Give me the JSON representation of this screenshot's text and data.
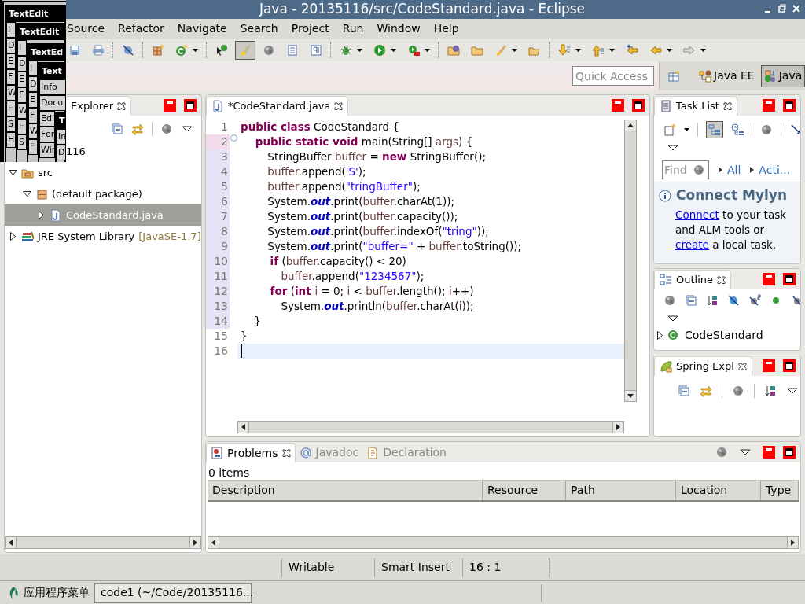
{
  "window": {
    "title": "Java - 20135116/src/CodeStandard.java - Eclipse"
  },
  "textedit_windows": [
    {
      "title": "TextEdit",
      "items": [
        {
          "label": "I",
          "disabled": false
        },
        {
          "label": "D",
          "disabled": false
        },
        {
          "label": "E",
          "disabled": false
        },
        {
          "label": "F",
          "disabled": false
        },
        {
          "label": "W",
          "disabled": false
        },
        {
          "label": "F",
          "disabled": true
        },
        {
          "label": "S",
          "disabled": false
        },
        {
          "label": "H",
          "disabled": false
        }
      ]
    },
    {
      "title": "TextEdit",
      "items": [
        {
          "label": "I",
          "disabled": false
        },
        {
          "label": "D",
          "disabled": false
        },
        {
          "label": "E",
          "disabled": false
        },
        {
          "label": "F",
          "disabled": false
        },
        {
          "label": "W",
          "disabled": false
        },
        {
          "label": "F",
          "disabled": true
        },
        {
          "label": "S",
          "disabled": false
        }
      ]
    },
    {
      "title": "TextEd",
      "items": [
        {
          "label": "I",
          "disabled": false
        },
        {
          "label": "D",
          "disabled": false
        },
        {
          "label": "E",
          "disabled": false
        },
        {
          "label": "F",
          "disabled": false
        },
        {
          "label": "W",
          "disabled": false
        },
        {
          "label": "F",
          "disabled": true
        }
      ]
    },
    {
      "title": "Text",
      "items": [
        {
          "label": "Info",
          "disabled": false
        },
        {
          "label": "Docu",
          "disabled": false
        },
        {
          "label": "Edi",
          "disabled": false
        },
        {
          "label": "For",
          "disabled": false
        },
        {
          "label": "Wir",
          "disabled": false
        }
      ]
    },
    {
      "title": "T",
      "items": [
        {
          "label": "In",
          "disabled": false
        },
        {
          "label": "D",
          "disabled": false
        }
      ]
    }
  ],
  "menu": [
    "Source",
    "Refactor",
    "Navigate",
    "Search",
    "Project",
    "Run",
    "Window",
    "Help"
  ],
  "toolbar": [
    [
      {
        "kind": "save",
        "dropdown": false,
        "selected": false
      },
      {
        "kind": "print",
        "dropdown": false,
        "selected": false
      }
    ],
    [
      {
        "kind": "hide",
        "dropdown": false,
        "selected": false
      }
    ],
    [
      {
        "kind": "new-package",
        "dropdown": false,
        "selected": false
      },
      {
        "kind": "new-class",
        "dropdown": true,
        "selected": false
      }
    ],
    [
      {
        "kind": "open-type",
        "dropdown": false,
        "selected": false
      },
      {
        "kind": "highlight",
        "dropdown": false,
        "selected": true
      },
      {
        "kind": "blob",
        "dropdown": false,
        "selected": false
      },
      {
        "kind": "document",
        "dropdown": false,
        "selected": false
      },
      {
        "kind": "paragraph",
        "dropdown": false,
        "selected": false
      }
    ],
    [
      {
        "kind": "debug",
        "dropdown": true,
        "selected": false
      },
      {
        "kind": "run",
        "dropdown": true,
        "selected": false
      },
      {
        "kind": "run-tool",
        "dropdown": true,
        "selected": false
      }
    ],
    [
      {
        "kind": "folder-globe",
        "dropdown": false,
        "selected": false
      },
      {
        "kind": "folder",
        "dropdown": false,
        "selected": false
      },
      {
        "kind": "brush",
        "dropdown": true,
        "selected": false
      },
      {
        "kind": "folder-open",
        "dropdown": false,
        "selected": false
      }
    ],
    [
      {
        "kind": "arrow-down",
        "dropdown": true,
        "selected": false
      },
      {
        "kind": "arrow-up",
        "dropdown": true,
        "selected": false
      },
      {
        "kind": "arrow-star",
        "dropdown": false,
        "selected": false
      },
      {
        "kind": "arrow-left",
        "dropdown": true,
        "selected": false
      },
      {
        "kind": "arrow-right",
        "dropdown": true,
        "selected": false
      }
    ]
  ],
  "quick_access": {
    "placeholder": "Quick Access"
  },
  "perspectives": [
    {
      "label": "Java EE",
      "selected": false
    },
    {
      "label": "Java",
      "selected": true
    }
  ],
  "package_explorer": {
    "tab": "Explorer",
    "tree": [
      {
        "label": "116",
        "selected": false,
        "children": [
          {
            "label": "src",
            "kind": "source-folder",
            "expanded": true,
            "selected": false,
            "children": [
              {
                "label": "(default package)",
                "kind": "package",
                "expanded": true,
                "selected": false,
                "children": [
                  {
                    "label": "CodeStandard.java",
                    "kind": "java-file",
                    "expanded": false,
                    "selected": true
                  }
                ]
              }
            ]
          },
          {
            "label": "JRE System Library",
            "decoration": "[JavaSE-1.7]",
            "kind": "library",
            "expanded": false,
            "selected": false
          }
        ]
      }
    ]
  },
  "editor": {
    "tab": "*CodeStandard.java",
    "lines": [
      {
        "number": "1",
        "range": false,
        "fold": false,
        "current": false,
        "tokens": [
          {
            "kind": "keyword",
            "text": "public class"
          },
          {
            "kind": "plain",
            "text": " CodeStandard {"
          }
        ]
      },
      {
        "number": "2",
        "range": true,
        "fold": true,
        "current": false,
        "tokens": [
          {
            "kind": "keyword",
            "text": "    public static void"
          },
          {
            "kind": "plain",
            "text": " main(String[] "
          },
          {
            "kind": "variable",
            "text": "args"
          },
          {
            "kind": "plain",
            "text": ") {"
          }
        ]
      },
      {
        "number": "3",
        "range": true,
        "fold": false,
        "current": false,
        "tokens": [
          {
            "kind": "plain",
            "text": "        StringBuffer "
          },
          {
            "kind": "variable",
            "text": "buffer"
          },
          {
            "kind": "plain",
            "text": " = "
          },
          {
            "kind": "keyword",
            "text": "new"
          },
          {
            "kind": "plain",
            "text": " StringBuffer();"
          }
        ]
      },
      {
        "number": "4",
        "range": true,
        "fold": false,
        "current": false,
        "tokens": [
          {
            "kind": "variable",
            "text": "        buffer"
          },
          {
            "kind": "plain",
            "text": ".append("
          },
          {
            "kind": "string",
            "text": "'S'"
          },
          {
            "kind": "plain",
            "text": ");"
          }
        ]
      },
      {
        "number": "5",
        "range": true,
        "fold": false,
        "current": false,
        "tokens": [
          {
            "kind": "variable",
            "text": "        buffer"
          },
          {
            "kind": "plain",
            "text": ".append("
          },
          {
            "kind": "string",
            "text": "\"tringBuffer\""
          },
          {
            "kind": "plain",
            "text": ");"
          }
        ]
      },
      {
        "number": "6",
        "range": true,
        "fold": false,
        "current": false,
        "tokens": [
          {
            "kind": "plain",
            "text": "        System."
          },
          {
            "kind": "field",
            "text": "out"
          },
          {
            "kind": "plain",
            "text": ".print("
          },
          {
            "kind": "variable",
            "text": "buffer"
          },
          {
            "kind": "plain",
            "text": ".charAt(1));"
          }
        ]
      },
      {
        "number": "7",
        "range": true,
        "fold": false,
        "current": false,
        "tokens": [
          {
            "kind": "plain",
            "text": "        System."
          },
          {
            "kind": "field",
            "text": "out"
          },
          {
            "kind": "plain",
            "text": ".print("
          },
          {
            "kind": "variable",
            "text": "buffer"
          },
          {
            "kind": "plain",
            "text": ".capacity());"
          }
        ]
      },
      {
        "number": "8",
        "range": true,
        "fold": false,
        "current": false,
        "tokens": [
          {
            "kind": "plain",
            "text": "        System."
          },
          {
            "kind": "field",
            "text": "out"
          },
          {
            "kind": "plain",
            "text": ".print("
          },
          {
            "kind": "variable",
            "text": "buffer"
          },
          {
            "kind": "plain",
            "text": ".indexOf("
          },
          {
            "kind": "string",
            "text": "\"tring\""
          },
          {
            "kind": "plain",
            "text": "));"
          }
        ]
      },
      {
        "number": "9",
        "range": true,
        "fold": false,
        "current": false,
        "tokens": [
          {
            "kind": "plain",
            "text": "        System."
          },
          {
            "kind": "field",
            "text": "out"
          },
          {
            "kind": "plain",
            "text": ".print("
          },
          {
            "kind": "string",
            "text": "\"buffer=\""
          },
          {
            "kind": "plain",
            "text": " + "
          },
          {
            "kind": "variable",
            "text": "buffer"
          },
          {
            "kind": "plain",
            "text": ".toString());"
          }
        ]
      },
      {
        "number": "10",
        "range": true,
        "fold": false,
        "current": false,
        "tokens": [
          {
            "kind": "keyword",
            "text": "        if"
          },
          {
            "kind": "plain",
            "text": " ("
          },
          {
            "kind": "variable",
            "text": "buffer"
          },
          {
            "kind": "plain",
            "text": ".capacity() < 20)"
          }
        ]
      },
      {
        "number": "11",
        "range": true,
        "fold": false,
        "current": false,
        "tokens": [
          {
            "kind": "variable",
            "text": "            buffer"
          },
          {
            "kind": "plain",
            "text": ".append("
          },
          {
            "kind": "string",
            "text": "\"1234567\""
          },
          {
            "kind": "plain",
            "text": ");"
          }
        ]
      },
      {
        "number": "12",
        "range": true,
        "fold": false,
        "current": false,
        "tokens": [
          {
            "kind": "keyword",
            "text": "        for"
          },
          {
            "kind": "plain",
            "text": " ("
          },
          {
            "kind": "keyword",
            "text": "int "
          },
          {
            "kind": "variable",
            "text": "i"
          },
          {
            "kind": "plain",
            "text": " = 0; "
          },
          {
            "kind": "variable",
            "text": "i"
          },
          {
            "kind": "plain",
            "text": " < "
          },
          {
            "kind": "variable",
            "text": "buffer"
          },
          {
            "kind": "plain",
            "text": ".length(); "
          },
          {
            "kind": "variable",
            "text": "i"
          },
          {
            "kind": "plain",
            "text": "++)"
          }
        ]
      },
      {
        "number": "13",
        "range": true,
        "fold": false,
        "current": false,
        "tokens": [
          {
            "kind": "plain",
            "text": "            System."
          },
          {
            "kind": "field",
            "text": "out"
          },
          {
            "kind": "plain",
            "text": ".println("
          },
          {
            "kind": "variable",
            "text": "buffer"
          },
          {
            "kind": "plain",
            "text": ".charAt("
          },
          {
            "kind": "variable",
            "text": "i"
          },
          {
            "kind": "plain",
            "text": "));"
          }
        ]
      },
      {
        "number": "14",
        "range": true,
        "fold": false,
        "current": false,
        "tokens": [
          {
            "kind": "plain",
            "text": "    }"
          }
        ]
      },
      {
        "number": "15",
        "range": false,
        "fold": false,
        "current": false,
        "tokens": [
          {
            "kind": "plain",
            "text": "}"
          }
        ]
      },
      {
        "number": "16",
        "range": false,
        "fold": false,
        "current": true
      }
    ]
  },
  "task_list": {
    "tab": "Task List",
    "find": {
      "placeholder": "Find"
    },
    "filters": [
      "All",
      "Acti..."
    ],
    "mylyn": {
      "title": "Connect Mylyn",
      "text": [
        {
          "text": "Connect",
          "link": true
        },
        {
          "text": " to your task and ALM tools or ",
          "link": false
        },
        {
          "text": "create",
          "link": true
        },
        {
          "text": " a local task.",
          "link": false
        }
      ]
    }
  },
  "outline": {
    "tab": "Outline",
    "tree": [
      {
        "label": "CodeStandard",
        "expanded": false
      }
    ]
  },
  "spring_explorer": {
    "tab": "Spring Expl"
  },
  "problems": {
    "tabs": [
      {
        "label": "Problems",
        "selected": true
      },
      {
        "label": "Javadoc",
        "selected": false
      },
      {
        "label": "Declaration",
        "selected": false
      }
    ],
    "summary": "0 items",
    "table": {
      "columns": [
        "Description",
        "Resource",
        "Path",
        "Location",
        "Type"
      ]
    }
  },
  "status_bar": [
    "Writable",
    "Smart Insert",
    "16 : 1"
  ],
  "taskbar": {
    "menu": "应用程序菜单",
    "tasks": [
      "code1 (~/Code/20135116..."
    ]
  }
}
